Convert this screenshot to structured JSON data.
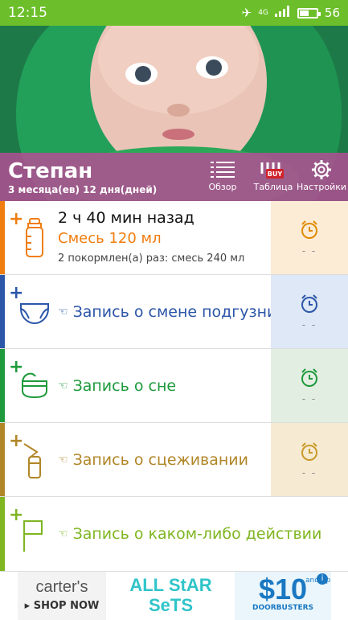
{
  "status": {
    "time": "12:15",
    "network": "4G",
    "battery": "56",
    "battery_level": 0.56
  },
  "header": {
    "child_name": "Степан",
    "child_age": "3 месяца(ев) 12 дня(дней)",
    "buttons": {
      "overview": "Обзор",
      "table": "Таблица",
      "table_badge": "BUY",
      "settings": "Настройки"
    }
  },
  "rows": {
    "feeding": {
      "title": "2 ч 40 мин назад",
      "subtitle": "Смесь 120 мл",
      "note": "2 покормлен(а) раз: смесь 240 мл",
      "alarm_value": "- -",
      "color": "#f07d10",
      "alarm_bg": "#fcecd6"
    },
    "diaper": {
      "label": "Запись о смене подгузника",
      "alarm_value": "- -",
      "color": "#2c56a8",
      "alarm_bg": "#dfe8f7"
    },
    "sleep": {
      "label": "Запись о сне",
      "alarm_value": "- -",
      "color": "#1e9a3c",
      "alarm_bg": "#e3eee2"
    },
    "pumping": {
      "label": "Запись о сцеживании",
      "alarm_value": "- -",
      "color": "#b18628",
      "alarm_bg": "#f6ead2"
    },
    "activity": {
      "label": "Запись о каком-либо действии",
      "color": "#7fb621"
    }
  },
  "ad": {
    "brand": "carter's",
    "shop_now": "SHOP NOW",
    "line1": "ALL StAR",
    "line2": "SeTS",
    "price": "$10",
    "and_up": "and up",
    "retailer": "DOORBUSTERS",
    "info": "i"
  }
}
